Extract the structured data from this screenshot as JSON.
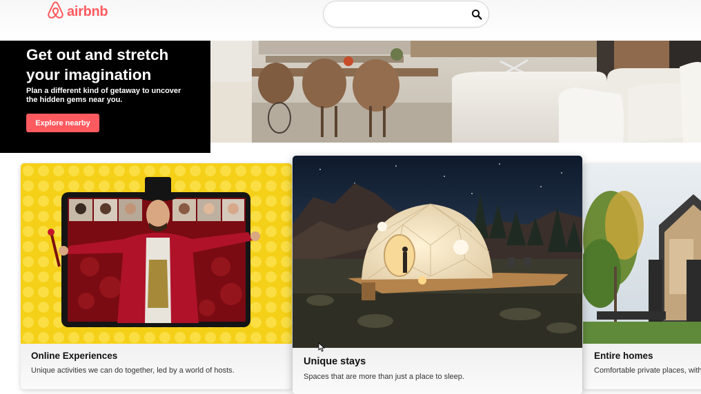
{
  "brand": {
    "name": "airbnb",
    "color": "#ff5a5f",
    "logo_icon": "airbnb-belo-icon"
  },
  "search": {
    "value": "",
    "placeholder": "",
    "icon": "search-icon"
  },
  "hero": {
    "title": "Get out and stretch your imagination",
    "subtitle": "Plan a different kind of getaway to uncover the hidden gems near you.",
    "button_label": "Explore nearby",
    "panel_color": "#000000"
  },
  "cards": [
    {
      "title": "Online Experiences",
      "description": "Unique activities we can do together, led by a world of hosts.",
      "image": "ringmaster-on-tablet"
    },
    {
      "title": "Unique stays",
      "description": "Spaces that are more than just a place to sleep.",
      "image": "geodesic-dome-at-night"
    },
    {
      "title": "Entire homes",
      "description": "Comfortable private places, with",
      "image": "modern-house-with-trees"
    }
  ]
}
